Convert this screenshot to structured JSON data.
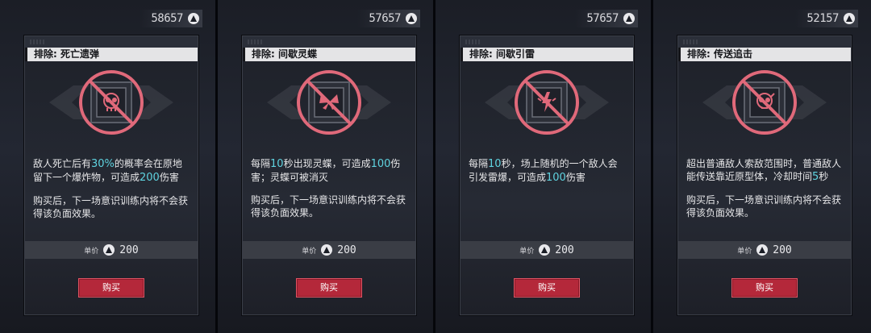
{
  "cards": [
    {
      "currency": "58657",
      "title": "排除: 死亡遗弹",
      "desc1_parts": [
        "敌人死亡后有",
        "30%",
        "的概率会在原地留下一个爆炸物，可造成",
        "200",
        "伤害"
      ],
      "desc2": "购买后，下一场意识训练内将不会获得该负面效果。",
      "price_label": "单价",
      "price": "200",
      "buy_label": "购买",
      "icon": "skull-icon"
    },
    {
      "currency": "57657",
      "title": "排除: 间歇灵蝶",
      "desc1_parts": [
        "每隔",
        "10",
        "秒出现灵蝶，可造成",
        "100",
        "伤害；灵蝶可被消灭"
      ],
      "desc2": "购买后，下一场意识训练内将不会获得该负面效果。",
      "price_label": "单价",
      "price": "200",
      "buy_label": "购买",
      "icon": "butterfly-icon"
    },
    {
      "currency": "57657",
      "title": "排除: 间歇引雷",
      "desc1_parts": [
        "每隔",
        "10",
        "秒，场上随机的一个敌人会引发雷爆，可造成",
        "100",
        "伤害"
      ],
      "desc2": "",
      "price_label": "单价",
      "price": "200",
      "buy_label": "购买",
      "icon": "lightning-icon"
    },
    {
      "currency": "52157",
      "title": "排除: 传送追击",
      "desc1_parts": [
        "超出普通敌人索敌范围时，普通敌人能传送靠近原型体，冷却时间",
        "5",
        "秒",
        "",
        ""
      ],
      "desc2": "购买后，下一场意识训练内将不会获得该负面效果。",
      "price_label": "单价",
      "price": "200",
      "buy_label": "购买",
      "icon": "teleport-skull-icon"
    }
  ],
  "colors": {
    "highlight": "#5fd3e0",
    "buy": "#b4283a",
    "prohibit": "#e0697a"
  }
}
